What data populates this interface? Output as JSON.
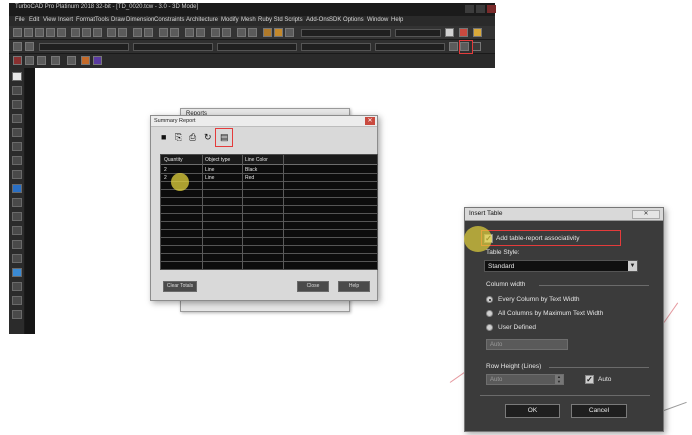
{
  "app": {
    "title": "TurboCAD Pro Platinum 2018 32-bit - [TD_0020.tcw - 3.0 - 3D Mode]",
    "menu": [
      "File",
      "Edit",
      "View",
      "Insert",
      "Format",
      "Tools",
      "Draw",
      "Dimension",
      "Constraints",
      "Architecture",
      "Modify",
      "Mesh",
      "Ruby Std Scripts",
      "Add-Ons",
      "SDK",
      "Options",
      "Window",
      "Help"
    ]
  },
  "reports_window": {
    "title": "Reports"
  },
  "summary_report": {
    "title": "Summary Report",
    "toolbar": [
      "save-icon",
      "copy-icon",
      "print-icon",
      "refresh-icon",
      "insert-table-icon"
    ],
    "columns": [
      "Quantity",
      "Object type",
      "Line Color"
    ],
    "rows": [
      {
        "quantity": "2",
        "object_type": "Line",
        "line_color": "Black"
      },
      {
        "quantity": "2",
        "object_type": "Line",
        "line_color": "Red"
      }
    ],
    "buttons": {
      "clear": "Clear Totals",
      "close": "Close",
      "help": "Help"
    }
  },
  "insert_table": {
    "title": "Insert Table",
    "close_label": "✕",
    "associativity_label": "Add table-report associativity",
    "associativity_checked": true,
    "table_style_label": "Table Style:",
    "table_style_value": "Standard",
    "column_width_label": "Column width",
    "column_width_options": [
      {
        "label": "Every Column by Text Width",
        "selected": true
      },
      {
        "label": "All Columns by Maximum Text Width",
        "selected": false
      },
      {
        "label": "User Defined",
        "selected": false
      }
    ],
    "column_width_value": "Auto",
    "row_height_label": "Row Height (Lines)",
    "row_height_value": "Auto",
    "row_auto_label": "Auto",
    "row_auto_checked": true,
    "ok_label": "OK",
    "cancel_label": "Cancel"
  },
  "colors": {
    "highlight": "#e43b3b",
    "cursor_marker": "#e2d23c",
    "dialog_dark": "#3b3b3b",
    "grid_bg": "#0c0c0c"
  }
}
